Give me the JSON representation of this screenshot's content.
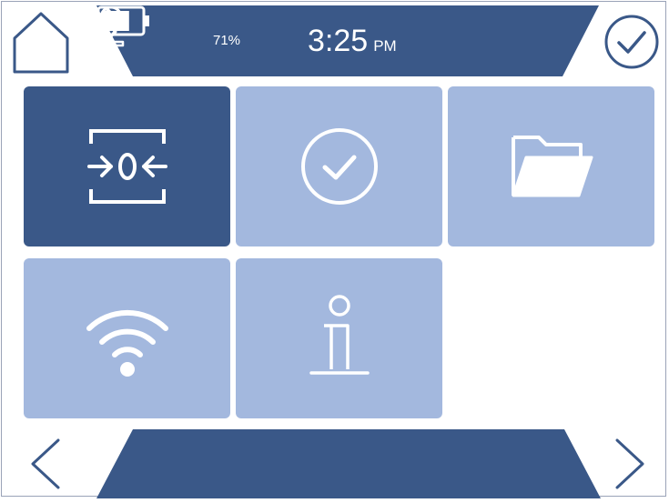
{
  "status": {
    "battery_percent": "71%",
    "battery_level": 0.71,
    "time": "3:25",
    "ampm": "PM"
  },
  "colors": {
    "primary_dark": "#3a5888",
    "tile_light": "#a3b8de",
    "outline": "#3a5888",
    "icon_white": "#ffffff"
  },
  "tiles": [
    {
      "icon": "zero-calibration-icon",
      "active": true
    },
    {
      "icon": "check-circle-icon",
      "active": false
    },
    {
      "icon": "folder-icon",
      "active": false
    },
    {
      "icon": "wifi-icon",
      "active": false
    },
    {
      "icon": "info-icon",
      "active": false
    }
  ],
  "header": {
    "left_icon": "home-icon",
    "right_icon": "check-circle-icon"
  },
  "footer": {
    "left_icon": "chevron-left-icon",
    "right_icon": "chevron-right-icon"
  }
}
